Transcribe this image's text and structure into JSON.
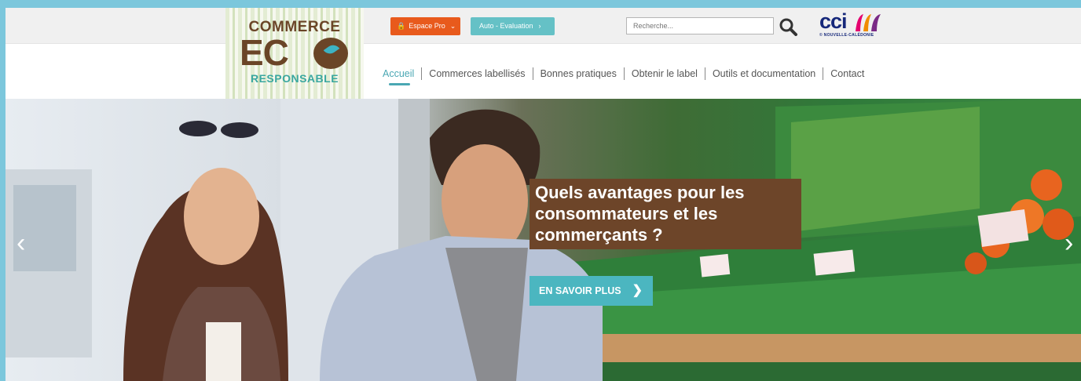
{
  "header": {
    "logo": {
      "line1": "COMMERCE",
      "line2": "EC",
      "line3": "RESPONSABLE"
    },
    "espace_pro_label": "Espace Pro",
    "auto_eval_label": "Auto - Evaluation",
    "search": {
      "placeholder": "Recherche..."
    },
    "cci": {
      "name": "cci",
      "sub": "© NOUVELLE-CALÉDONIE"
    }
  },
  "nav": {
    "items": [
      {
        "label": "Accueil"
      },
      {
        "label": "Commerces labellisés"
      },
      {
        "label": "Bonnes pratiques"
      },
      {
        "label": "Obtenir le label"
      },
      {
        "label": "Outils et documentation"
      },
      {
        "label": "Contact"
      }
    ]
  },
  "hero": {
    "headline": "Quels avantages pour les consommateurs et les commerçants ?",
    "cta_label": "EN SAVOIR PLUS"
  },
  "icons": {
    "lock": "lock-icon",
    "chevron": "chevron-icon",
    "search": "search-icon",
    "prev": "chevron-left-icon",
    "next": "chevron-right-icon"
  },
  "colors": {
    "orange": "#e85a1c",
    "teal": "#4bb6c0",
    "brown": "#6d4529",
    "navy": "#16287a"
  }
}
